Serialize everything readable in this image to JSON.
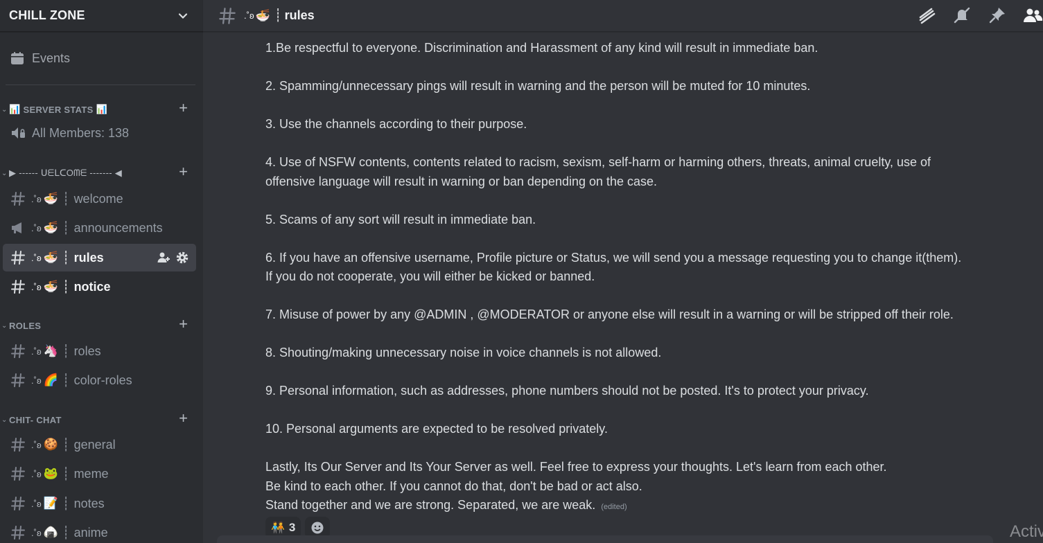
{
  "server": {
    "name": "CHILL ZONE"
  },
  "sidebar": {
    "events_label": "Events",
    "categories": [
      {
        "title": "SERVER STATS",
        "emoji_left": "📊",
        "emoji_right": "📊"
      },
      {
        "title": "▶ ------ ᑌᗴᒪᑕOᗰᗴ ------- ◀"
      },
      {
        "title": "ROLES"
      },
      {
        "title": "CHIT- CHAT"
      }
    ],
    "stat": {
      "label": "All Members: 138"
    },
    "channels": [
      {
        "prefix": ".˚ʚ",
        "emoji": "🍜",
        "bar": "┊",
        "name": "welcome"
      },
      {
        "prefix": ".˚ʚ",
        "emoji": "🍜",
        "bar": "┊",
        "name": "announcements"
      },
      {
        "prefix": ".˚ʚ",
        "emoji": "🍜",
        "bar": "┊",
        "name": "rules"
      },
      {
        "prefix": ".˚ʚ",
        "emoji": "🍜",
        "bar": "┊",
        "name": "notice"
      },
      {
        "prefix": ".˚ʚ",
        "emoji": "🦄",
        "bar": "┊",
        "name": "roles"
      },
      {
        "prefix": ".˚ʚ",
        "emoji": "🌈",
        "bar": "┊",
        "name": "color-roles"
      },
      {
        "prefix": ".˚ʚ",
        "emoji": "🍪",
        "bar": "┊",
        "name": "general"
      },
      {
        "prefix": ".˚ʚ",
        "emoji": "🐸",
        "bar": "┊",
        "name": "meme"
      },
      {
        "prefix": ".˚ʚ",
        "emoji": "📝",
        "bar": "┊",
        "name": "notes"
      },
      {
        "prefix": ".˚ʚ",
        "emoji": "🍙",
        "bar": "┊",
        "name": "anime"
      }
    ]
  },
  "header": {
    "prefix": ".˚ʚ",
    "emoji": "🍜",
    "bar": "┊",
    "name": "rules"
  },
  "message": {
    "lines": [
      "1.Be respectful to everyone. Discrimination and Harassment of any kind will result in immediate ban.",
      "",
      "2. Spamming/unnecessary pings will result in warning and the person will be muted for 10 minutes.",
      "",
      "3. Use the channels according to their purpose.",
      "",
      "4. Use of NSFW contents, contents related to racism, sexism, self-harm or harming others, threats, animal cruelty, use of",
      "offensive language will result in warning or ban depending on the case.",
      "",
      "5. Scams of any sort will result in immediate ban.",
      "",
      "6. If you have an offensive username, Profile picture or Status, we will send you a message requesting you to change it(them).",
      "If you do not cooperate, you will either be kicked or banned.",
      "",
      "7. Misuse of power by any @ADMIN , @MODERATOR or anyone else will result in a warning or will be stripped off their role.",
      "",
      "8. Shouting/making unnecessary noise in voice channels is not allowed.",
      "",
      "9. Personal information, such as addresses, phone numbers should not be posted. It's to protect your privacy.",
      "",
      "10. Personal arguments are expected to be resolved privately.",
      "",
      "Lastly, Its Our Server and Its Your Server as well. Feel free to express your thoughts. Let's learn from each other.",
      "Be kind to each other. If you cannot do that, don't be bad or act also.",
      "Stand together and we are strong. Separated, we are weak."
    ],
    "edited_label": "(edited)",
    "reaction": {
      "emoji": "🧑‍🤝‍🧑",
      "count": "3"
    }
  },
  "overlay": {
    "activate_text": "Activ"
  },
  "colors": {
    "background": "#313338",
    "sidebar": "#2b2d31",
    "active_channel": "#404249",
    "muted_text": "#949ba4"
  }
}
